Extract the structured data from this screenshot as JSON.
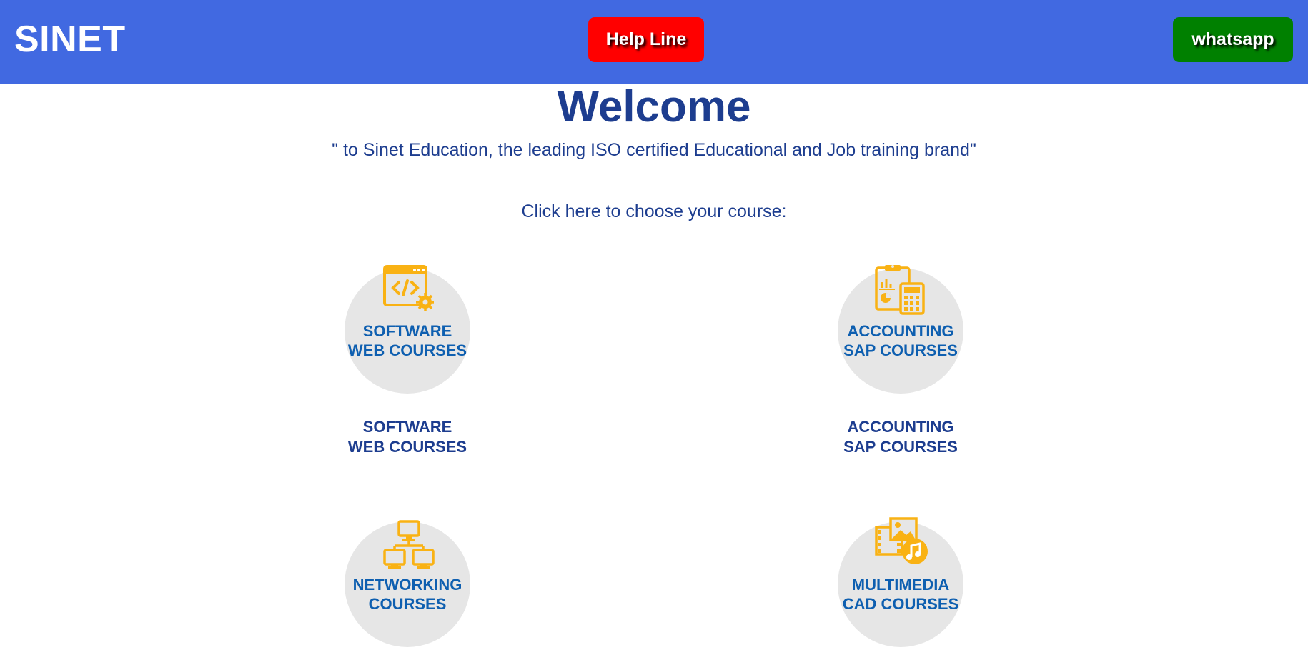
{
  "header": {
    "brand": "SINET",
    "help_label": "Help Line",
    "whatsapp_label": "whatsapp"
  },
  "hero": {
    "title": "Welcome",
    "tagline": "\" to Sinet Education, the leading ISO certified Educational and Job training brand\"",
    "prompt": "Click here to choose your course:"
  },
  "courses": [
    {
      "line1": "SOFTWARE",
      "line2": "WEB COURSES",
      "icon": "code-window-icon"
    },
    {
      "line1": "ACCOUNTING",
      "line2": "SAP COURSES",
      "icon": "clipboard-calculator-icon"
    },
    {
      "line1": "NETWORKING",
      "line2": "COURSES",
      "icon": "network-icon"
    },
    {
      "line1": "MULTIMEDIA",
      "line2": "CAD COURSES",
      "icon": "media-icon"
    }
  ],
  "colors": {
    "header_bg": "#4169e1",
    "help_bg": "#ff0000",
    "whatsapp_bg": "#008000",
    "text_primary": "#1d3d8f",
    "icon_accent": "#f9b214",
    "circle_bg": "#e6e6e6",
    "circle_text": "#0e5fb0"
  }
}
